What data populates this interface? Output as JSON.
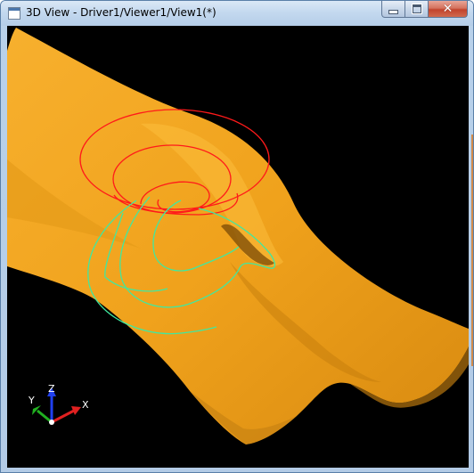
{
  "window": {
    "title": "3D View - Driver1/Viewer1/View1(*)",
    "controls": {
      "minimize": "minimize",
      "maximize": "maximize",
      "close": "close"
    }
  },
  "viewer": {
    "background_color": "#000000",
    "surface_color": "#f5a623",
    "helix_color": "#ff1a1a",
    "projected_curve_color": "#40e8a0"
  },
  "triad": {
    "x_label": "X",
    "y_label": "Y",
    "z_label": "Z",
    "x_color": "#e02020",
    "y_color": "#20b020",
    "z_color": "#2040f0"
  }
}
